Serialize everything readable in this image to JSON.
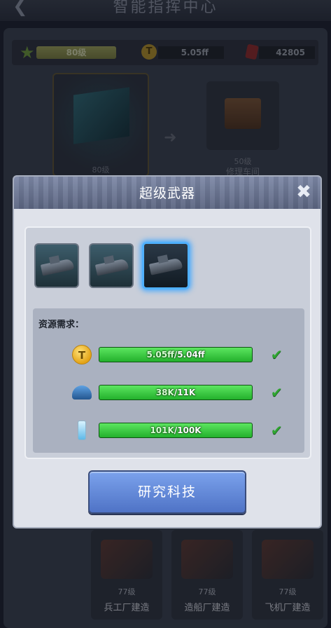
{
  "background": {
    "title": "智能指挥中心",
    "level_label": "80级",
    "gold_value": "5.05ff",
    "gem_value": "42805",
    "hq_level": "80级",
    "reward_level": "50级",
    "reward_name": "修理车间",
    "factories": [
      {
        "level": "77级",
        "name": "兵工厂建造"
      },
      {
        "level": "77级",
        "name": "造船厂建造"
      },
      {
        "level": "77级",
        "name": "飞机厂建造"
      }
    ]
  },
  "modal": {
    "title": "超级武器",
    "close_icon": "close-icon",
    "weapons": [
      {
        "icon": "battleship-icon",
        "selected": false
      },
      {
        "icon": "submarine-icon",
        "selected": false
      },
      {
        "icon": "destroyer-icon",
        "selected": true
      }
    ],
    "requirements_label": "资源需求：",
    "requirements": [
      {
        "icon": "gold-coin-icon",
        "have": "5.05ff",
        "need": "5.04ff",
        "fill": 1.0,
        "met": true
      },
      {
        "icon": "helmet-icon",
        "have": "38K",
        "need": "11K",
        "fill": 1.0,
        "met": true
      },
      {
        "icon": "energy-vial-icon",
        "have": "101K",
        "need": "100K",
        "fill": 1.0,
        "met": true
      }
    ],
    "research_button": "研究科技"
  },
  "colors": {
    "bar_green": "#3fcf45",
    "check_green": "#2fa531",
    "selected_glow": "#4fb0ff",
    "button_blue": "#5f86d8"
  }
}
